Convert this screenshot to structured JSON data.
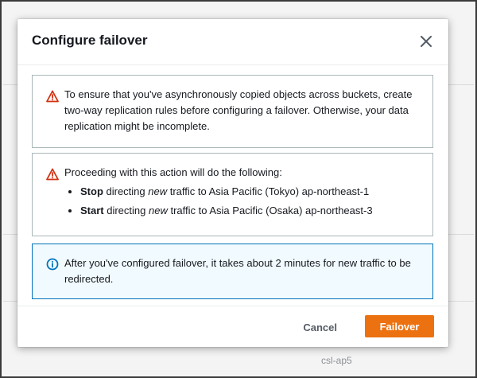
{
  "background": {
    "footer_text": "csl-ap5"
  },
  "modal": {
    "title": "Configure failover",
    "close_icon": "close-icon",
    "warning_replication": {
      "icon": "warning-icon",
      "text": "To ensure that you've asynchronously copied objects across buckets, create two-way replication rules before configuring a failover. Otherwise, your data replication might be incomplete."
    },
    "warning_actions": {
      "icon": "warning-icon",
      "intro": "Proceeding with this action will do the following:",
      "items": [
        {
          "bold": "Stop",
          "mid": " directing ",
          "italic": "new",
          "rest": " traffic to Asia Pacific (Tokyo) ap-northeast-1"
        },
        {
          "bold": "Start",
          "mid": " directing ",
          "italic": "new",
          "rest": " traffic to Asia Pacific (Osaka) ap-northeast-3"
        }
      ]
    },
    "info": {
      "icon": "info-icon",
      "text": "After you've configured failover, it takes about 2 minutes for new traffic to be redirected."
    },
    "footer": {
      "cancel_label": "Cancel",
      "failover_label": "Failover"
    }
  },
  "colors": {
    "primary_button": "#ec7211",
    "warning": "#d13212",
    "info": "#0073bb"
  }
}
